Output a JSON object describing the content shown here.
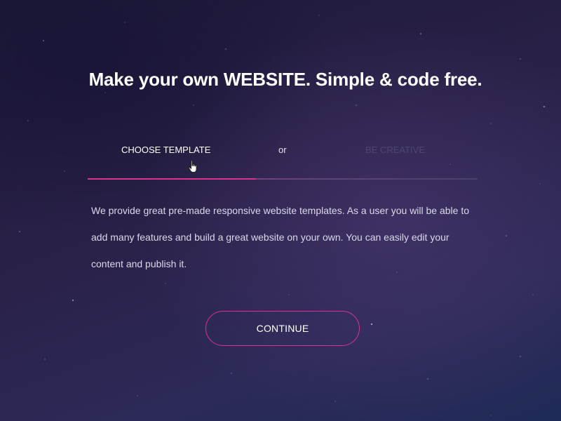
{
  "header": {
    "title": "Make your own WEBSITE. Simple & code free."
  },
  "tabs": {
    "items": [
      {
        "label": "CHOOSE TEMPLATE",
        "active": true
      },
      {
        "label": "BE CREATIVE",
        "active": false
      }
    ],
    "separator": "or"
  },
  "content": {
    "description": "We provide great pre-made responsive website templates. As a user you will be able to add many features and build a great website on your own. You can easily edit your content and publish it."
  },
  "actions": {
    "continue_label": "CONTINUE"
  },
  "colors": {
    "accent": "#d5358f",
    "background_dark": "#1c1937",
    "background_light": "#2c2a58",
    "inactive_tab": "#4e4870"
  },
  "icons": {
    "cursor": "hand-pointer-icon"
  }
}
